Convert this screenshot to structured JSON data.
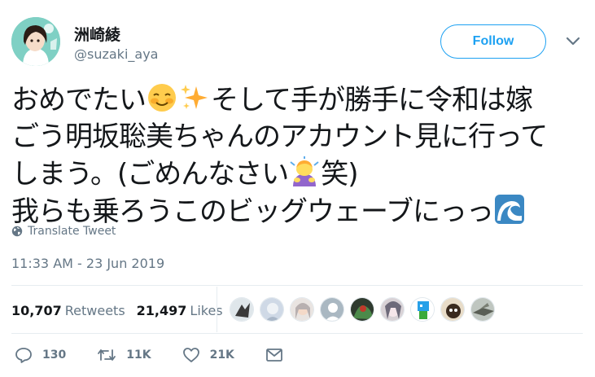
{
  "user": {
    "display_name": "洲崎綾",
    "handle": "@suzaki_aya",
    "follow_label": "Follow"
  },
  "tweet": {
    "line1_a": "おめでたい",
    "line1_b": "そして手が勝手に令和は嫁",
    "line2": "ごう明坂聡美ちゃんのアカウント見に行って",
    "line3_a": "しまう。(ごめんなさい",
    "line3_b": "笑)",
    "line4": "我らも乗ろうこのビッグウェーブにっっ",
    "emojis": [
      "smiling-blush-emoji",
      "sparkles-emoji",
      "person-bowing-emoji",
      "wave-emoji"
    ]
  },
  "translate_label": "Translate Tweet",
  "timestamp": "11:33 AM - 23 Jun 2019",
  "stats": {
    "retweets_count": "10,707",
    "retweets_label": "Retweets",
    "likes_count": "21,497",
    "likes_label": "Likes"
  },
  "actions": {
    "replies": "130",
    "retweets": "11K",
    "likes": "21K"
  },
  "colors": {
    "accent": "#1da1f2",
    "secondary_text": "#657786",
    "primary_text": "#14171a",
    "divider": "#e6ecf0"
  }
}
